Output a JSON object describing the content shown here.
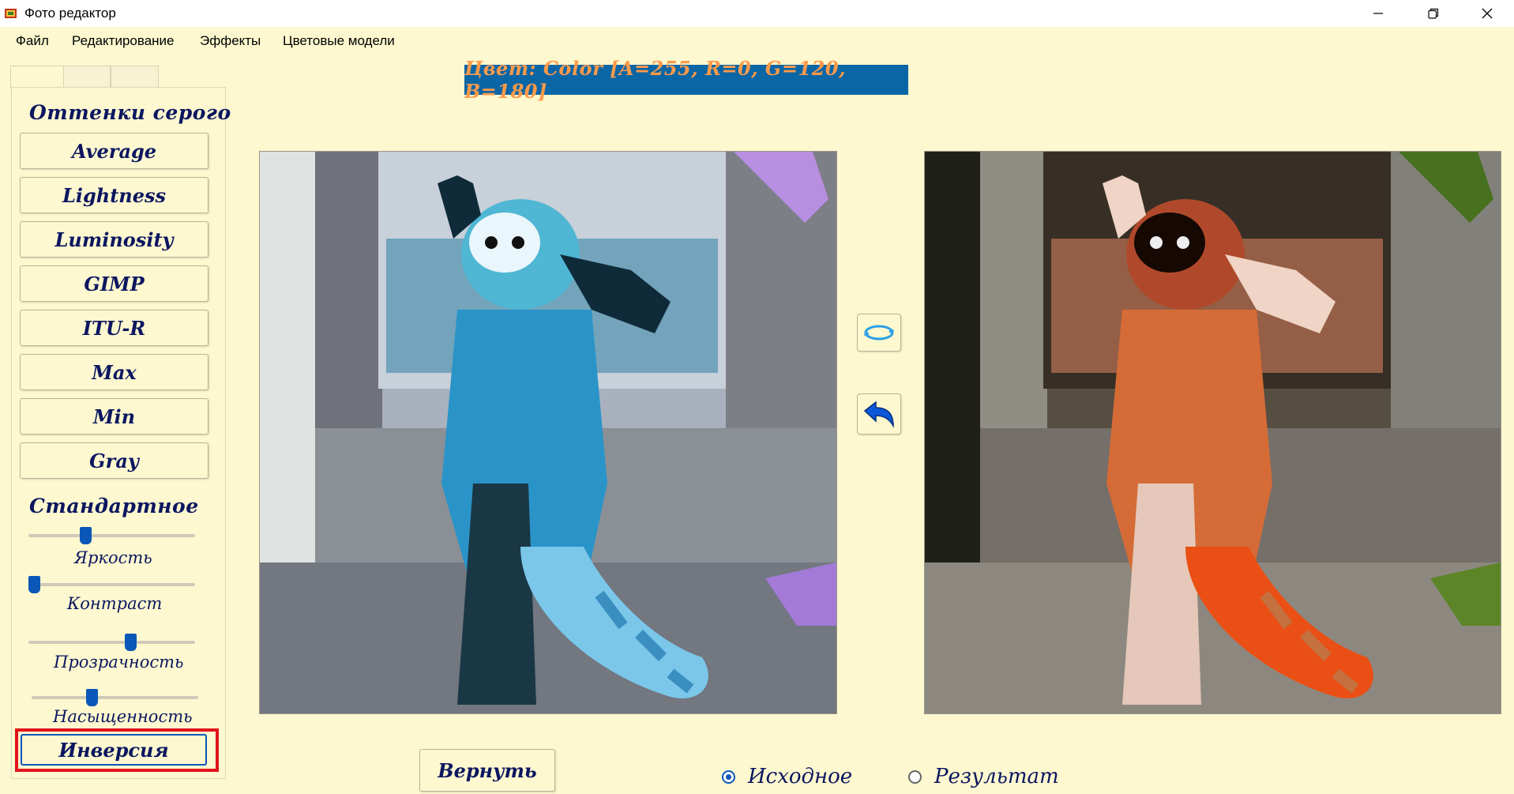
{
  "window": {
    "title": "Фото редактор"
  },
  "menu": [
    "Файл",
    "Редактирование",
    "Эффекты",
    "Цветовые модели"
  ],
  "color_info": "Цвет: Color [A=255, R=0, G=120, B=180]",
  "sidebar": {
    "grayscale_title": "Оттенки серого",
    "grayscale_buttons": [
      "Average",
      "Lightness",
      "Luminosity",
      "GIMP",
      "ITU-R",
      "Max",
      "Min",
      "Gray"
    ],
    "standard_title": "Стандартное",
    "sliders": [
      {
        "label": "Яркость",
        "value": 0.33
      },
      {
        "label": "Контраст",
        "value": 0.0
      },
      {
        "label": "Прозрачность",
        "value": 0.62
      },
      {
        "label": "Насыщенность",
        "value": 0.35
      }
    ],
    "invert_label": "Инверсия"
  },
  "return_label": "Вернуть",
  "radios": [
    {
      "label": "Исходное",
      "checked": true
    },
    {
      "label": "Результат",
      "checked": false
    }
  ],
  "colors": {
    "accent": "#0b57b8",
    "highlight": "#e2141b",
    "background": "#fdf8cf",
    "info_box": "#0b66a5",
    "info_text": "#ff9a4a"
  },
  "icons": {
    "rotate": "rotate-icon",
    "undo": "undo-arrow-icon"
  }
}
